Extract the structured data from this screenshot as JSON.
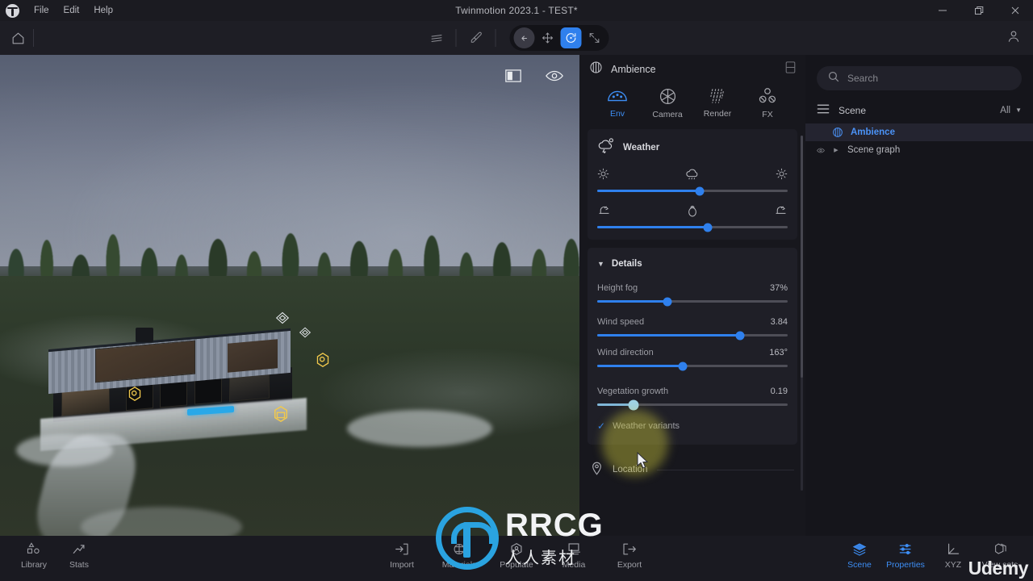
{
  "window": {
    "title": "Twinmotion 2023.1 - TEST*",
    "logo": "twinmotion-logo",
    "menu": [
      "File",
      "Edit",
      "Help"
    ],
    "controls": {
      "minimize": "–",
      "restore": "❐",
      "close": "✕"
    }
  },
  "toolbar": {
    "home": "home-icon",
    "layers": "layers-icon",
    "eyedropper": "eyedropper-icon",
    "back": "back-arrow-icon",
    "move": "move-tool-icon",
    "rotate": "rotate-tool-icon",
    "scale": "scale-tool-icon",
    "user": "user-account-icon",
    "active_tool": "rotate",
    "accent": "#2f80ed"
  },
  "viewport": {
    "panel_toggle": "panel-toggle-icon",
    "eye": "eye-visibility-icon"
  },
  "ambience": {
    "title": "Ambience",
    "dock_icon": "dock-panel-icon",
    "tabs": [
      {
        "label": "Env",
        "icon": "environment-icon",
        "active": true
      },
      {
        "label": "Camera",
        "icon": "camera-aperture-icon",
        "active": false
      },
      {
        "label": "Render",
        "icon": "render-rain-icon",
        "active": false
      },
      {
        "label": "FX",
        "icon": "fx-nodes-icon",
        "active": false
      }
    ],
    "weather": {
      "title": "Weather",
      "icon": "weather-cloud-icon",
      "sliders": [
        {
          "name": "cloudiness",
          "left_icon": "sun-icon",
          "center_icon": "rain-cloud-icon",
          "right_icon": "sun-icon",
          "percent": 54
        },
        {
          "name": "season",
          "left_icon": "tree-summer-icon",
          "center_icon": "tree-autumn-icon",
          "right_icon": "tree-winter-icon",
          "percent": 58
        }
      ]
    },
    "details": {
      "title": "Details",
      "caret": "▼",
      "properties": [
        {
          "label": "Height fog",
          "value": "37%",
          "percent": 37
        },
        {
          "label": "Wind speed",
          "value": "3.84",
          "percent": 75
        },
        {
          "label": "Wind direction",
          "value": "163°",
          "percent": 45
        },
        {
          "label": "Vegetation growth",
          "value": "0.19",
          "percent": 19
        }
      ],
      "checkbox": {
        "label": "Weather variants",
        "checked": true,
        "mark": "✓"
      }
    },
    "location": {
      "label": "Location",
      "icon": "map-pin-icon"
    }
  },
  "sidebar": {
    "search": {
      "placeholder": "Search",
      "value": "",
      "icon": "search-icon"
    },
    "scene": {
      "label": "Scene",
      "icon": "scene-list-icon",
      "filter": "All",
      "filter_caret": "▼"
    },
    "tree": [
      {
        "label": "Ambience",
        "icon": "ambience-globe-icon",
        "selected": true,
        "expandable": false
      },
      {
        "label": "Scene graph",
        "icon": "eye-icon",
        "selected": false,
        "expandable": true,
        "caret": "▶"
      }
    ]
  },
  "bottombar": {
    "left": [
      {
        "label": "Library",
        "icon": "library-shapes-icon"
      },
      {
        "label": "Stats",
        "icon": "stats-arrow-icon"
      }
    ],
    "center": [
      {
        "label": "Import",
        "icon": "import-icon"
      },
      {
        "label": "Materials",
        "icon": "materials-sphere-icon"
      },
      {
        "label": "Populate",
        "icon": "populate-person-icon"
      },
      {
        "label": "Media",
        "icon": "media-stack-icon"
      },
      {
        "label": "Export",
        "icon": "export-icon"
      }
    ],
    "right": [
      {
        "label": "Scene",
        "icon": "scene-layers-icon",
        "active": true
      },
      {
        "label": "Properties",
        "icon": "properties-sliders-icon",
        "active": true
      },
      {
        "label": "XYZ",
        "icon": "xyz-axis-icon",
        "active": false
      },
      {
        "label": "View sets",
        "icon": "view-sets-icon",
        "active": false
      }
    ]
  },
  "watermarks": {
    "rrcg": "RRCG",
    "rrcg_sub": "人人素材",
    "udemy": "Udemy"
  }
}
